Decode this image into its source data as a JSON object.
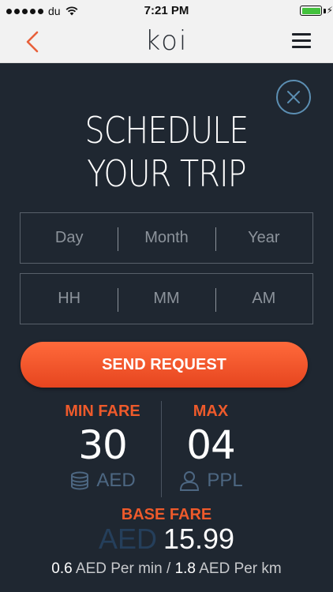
{
  "status_bar": {
    "carrier": "du",
    "time": "7:21 PM",
    "charging_symbol": "⚡"
  },
  "nav": {
    "logo": "koi",
    "back_icon": "chevron-left-icon",
    "menu_icon": "hamburger-menu-icon"
  },
  "colors": {
    "accent": "#ee5a2b",
    "background": "#1f2731",
    "muted_blue": "#4d6782"
  },
  "modal": {
    "title_line1": "SCHEDULE",
    "title_line2": "YOUR TRIP",
    "date_fields": [
      "Day",
      "Month",
      "Year"
    ],
    "time_fields": [
      "HH",
      "MM",
      "AM"
    ],
    "send_button": "SEND REQUEST"
  },
  "fare": {
    "min_label": "MIN FARE",
    "min_value": "30",
    "min_unit": "AED",
    "max_label": "MAX",
    "max_value": "04",
    "max_unit": "PPL",
    "base_label": "BASE FARE",
    "base_currency": "AED",
    "base_value": "15.99",
    "per_min_value": "0.6",
    "per_min_unit": "AED Per min",
    "separator": "/",
    "per_km_value": "1.8",
    "per_km_unit": "AED Per km"
  }
}
